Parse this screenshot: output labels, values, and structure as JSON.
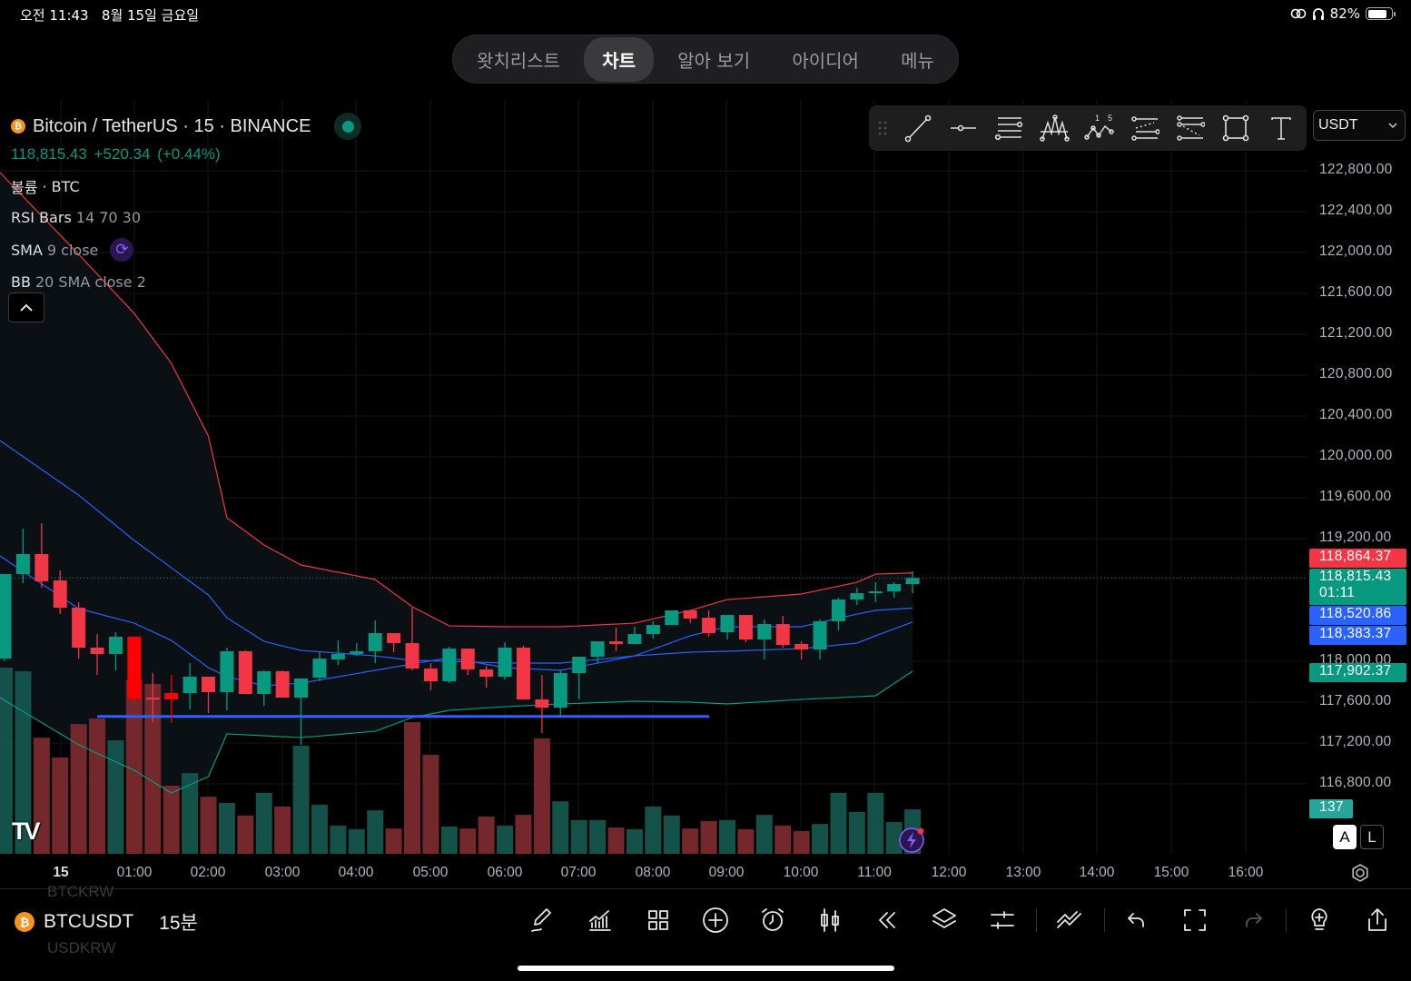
{
  "status_bar": {
    "time_date": "오전 11:43   8월 15일 금요일",
    "battery": "82%",
    "battery_level": 0.82,
    "icons": [
      "link-icon",
      "headphones-icon",
      "battery-icon"
    ]
  },
  "tabs": [
    {
      "label": "왓치리스트",
      "selected": false
    },
    {
      "label": "차트",
      "selected": true
    },
    {
      "label": "알아 보기",
      "selected": false
    },
    {
      "label": "아이디어",
      "selected": false
    },
    {
      "label": "메뉴",
      "selected": false
    }
  ],
  "legend": {
    "title": "Bitcoin / TetherUS · 15 · BINANCE",
    "quote": "118,815.43 +520.34 (+0.44%)",
    "indicators": [
      {
        "name": "볼륨",
        "params": "· BTC"
      },
      {
        "name": "RSI Bars",
        "params": "14 70 30"
      },
      {
        "name": "SMA",
        "params": "9 close"
      },
      {
        "name": "BB",
        "params": "20 SMA close 2"
      }
    ]
  },
  "drawing_toolbar": [
    "drag-handle-icon",
    "trend-line-icon",
    "horizontal-ray-icon",
    "fib-retracement-icon",
    "pattern-icon",
    "elliott-wave-icon",
    "parallel-channel-icon",
    "regression-trend-icon",
    "rectangle-icon",
    "text-icon"
  ],
  "currency_select": "USDT",
  "colors": {
    "up": "#089981",
    "down": "#f23645",
    "rsi_extreme": "#ff0000",
    "bb_upper": "#f23645",
    "bb_basis": "#2962ff",
    "bb_lower": "#089981",
    "sma": "#2962ff",
    "hline": "#2962ff"
  },
  "price_axis": {
    "labels": [
      "122,800.00",
      "122,400.00",
      "122,000.00",
      "121,600.00",
      "121,200.00",
      "120,800.00",
      "120,400.00",
      "120,000.00",
      "119,600.00",
      "119,200.00",
      "118,000.00",
      "117,600.00",
      "117,200.00",
      "116,800.00"
    ],
    "values": [
      122800,
      122400,
      122000,
      121600,
      121200,
      120800,
      120400,
      120000,
      119600,
      119200,
      118000,
      117600,
      117200,
      116800
    ]
  },
  "price_labels": [
    {
      "value": "118,864.37",
      "color": "#f23645",
      "price": 118864.37
    },
    {
      "value": "118,815.43",
      "sub": "01:11",
      "color": "#089981",
      "price": 118815.43
    },
    {
      "value": "118,520.86",
      "color": "#2962ff",
      "price": 118520.86
    },
    {
      "value": "118,383.37",
      "color": "#2962ff",
      "price": 118383.37
    },
    {
      "value": "117,902.37",
      "color": "#089981",
      "price": 117902.37
    }
  ],
  "volume_label": "137",
  "scale_buttons": {
    "auto": "A",
    "log": "L"
  },
  "time_axis": [
    "15",
    "01:00",
    "02:00",
    "03:00",
    "04:00",
    "05:00",
    "06:00",
    "07:00",
    "08:00",
    "09:00",
    "10:00",
    "11:00",
    "12:00",
    "13:00",
    "14:00",
    "15:00",
    "16:00"
  ],
  "chart_data": {
    "type": "candlestick",
    "symbol": "BTCUSDT",
    "interval": "15",
    "ylim": [
      116800,
      122800
    ],
    "columns": [
      "time",
      "open",
      "high",
      "low",
      "close",
      "volume"
    ],
    "candles": [
      [
        "23:15",
        118026,
        118853,
        118000,
        118853,
        574
      ],
      [
        "23:30",
        118853,
        119298,
        118764,
        119049,
        563
      ],
      [
        "23:45",
        119049,
        119351,
        118720,
        118782,
        358
      ],
      [
        "00:00",
        118791,
        118889,
        118462,
        118524,
        297
      ],
      [
        "00:15",
        118524,
        118578,
        118026,
        118133,
        400
      ],
      [
        "00:30",
        118133,
        118266,
        117866,
        118071,
        417
      ],
      [
        "00:45",
        118071,
        118284,
        117911,
        118240,
        350
      ],
      [
        "01:00",
        118240,
        118240,
        117600,
        117635,
        535
      ],
      [
        "01:15",
        117644,
        117884,
        117404,
        117626,
        524
      ],
      [
        "01:30",
        117689,
        117866,
        117395,
        117626,
        210
      ],
      [
        "01:45",
        117689,
        117982,
        117529,
        117849,
        249
      ],
      [
        "02:00",
        117849,
        117849,
        117493,
        117698,
        176
      ],
      [
        "02:15",
        117698,
        118133,
        117520,
        118098,
        157
      ],
      [
        "02:30",
        118098,
        118106,
        117680,
        117680,
        118
      ],
      [
        "02:45",
        117680,
        117911,
        117564,
        117902,
        188
      ],
      [
        "03:00",
        117902,
        117911,
        117644,
        117644,
        146
      ],
      [
        "03:15",
        117644,
        117831,
        117182,
        117831,
        333
      ],
      [
        "03:30",
        117840,
        118089,
        117804,
        118026,
        151
      ],
      [
        "03:45",
        118017,
        118204,
        117964,
        118071,
        87
      ],
      [
        "04:00",
        118071,
        118178,
        118053,
        118098,
        76
      ],
      [
        "04:15",
        118098,
        118400,
        117982,
        118275,
        134
      ],
      [
        "04:30",
        118275,
        118275,
        118089,
        118178,
        78
      ],
      [
        "04:45",
        118178,
        118524,
        117911,
        117929,
        406
      ],
      [
        "05:00",
        117929,
        117982,
        117715,
        117804,
        305
      ],
      [
        "05:15",
        117804,
        118142,
        117786,
        118124,
        84
      ],
      [
        "05:30",
        118124,
        118124,
        117866,
        117920,
        78
      ],
      [
        "05:45",
        117920,
        117955,
        117742,
        117849,
        115
      ],
      [
        "06:00",
        117849,
        118186,
        117822,
        118133,
        87
      ],
      [
        "06:15",
        118133,
        118151,
        117626,
        117626,
        120
      ],
      [
        "06:30",
        117626,
        117866,
        117298,
        117546,
        356
      ],
      [
        "06:45",
        117546,
        117911,
        117458,
        117884,
        162
      ],
      [
        "07:00",
        117884,
        118044,
        117626,
        118044,
        104
      ],
      [
        "07:15",
        118044,
        118195,
        117982,
        118195,
        104
      ],
      [
        "07:30",
        118195,
        118329,
        118098,
        118169,
        81
      ],
      [
        "07:45",
        118169,
        118338,
        118169,
        118266,
        76
      ],
      [
        "08:00",
        118266,
        118391,
        118222,
        118355,
        146
      ],
      [
        "08:15",
        118355,
        118498,
        118355,
        118498,
        118
      ],
      [
        "08:30",
        118498,
        118498,
        118373,
        118418,
        78
      ],
      [
        "08:45",
        118426,
        118498,
        118240,
        118275,
        101
      ],
      [
        "09:00",
        118284,
        118453,
        118213,
        118453,
        104
      ],
      [
        "09:15",
        118453,
        118453,
        118186,
        118213,
        76
      ],
      [
        "09:30",
        118213,
        118409,
        118017,
        118364,
        120
      ],
      [
        "09:45",
        118364,
        118444,
        118133,
        118160,
        87
      ],
      [
        "10:00",
        118169,
        118195,
        118017,
        118115,
        70
      ],
      [
        "10:15",
        118115,
        118409,
        118017,
        118391,
        92
      ],
      [
        "10:30",
        118391,
        118622,
        118302,
        118604,
        188
      ],
      [
        "10:45",
        118604,
        118720,
        118551,
        118666,
        129
      ],
      [
        "11:00",
        118675,
        118773,
        118578,
        118684,
        188
      ],
      [
        "11:15",
        118684,
        118773,
        118622,
        118755,
        98
      ],
      [
        "11:30",
        118755,
        118880,
        118666,
        118815.43,
        137
      ]
    ],
    "rsi_extreme_times": [
      "01:00",
      "01:30"
    ],
    "indicators": {
      "times": [
        "23:15",
        "00:15",
        "01:00",
        "01:30",
        "02:00",
        "02:15",
        "02:45",
        "03:15",
        "04:15",
        "04:45",
        "05:15",
        "06:00",
        "06:45",
        "07:45",
        "08:30",
        "09:00",
        "10:00",
        "10:45",
        "11:00",
        "11:30"
      ],
      "bb_upper": [
        122782,
        121982,
        121404,
        120915,
        120204,
        119404,
        119138,
        118942,
        118800,
        118533,
        118346,
        118338,
        118338,
        118373,
        118498,
        118604,
        118658,
        118773,
        118853,
        118864.37
      ],
      "bb_basis": [
        120160,
        119626,
        119182,
        118915,
        118649,
        118426,
        118195,
        118106,
        118053,
        118009,
        118000,
        117982,
        117982,
        118053,
        118089,
        118098,
        118124,
        118178,
        118249,
        118383.37
      ],
      "bb_lower": [
        117644,
        117182,
        116933,
        116711,
        116871,
        117289,
        117271,
        117253,
        117315,
        117449,
        117520,
        117555,
        117582,
        117609,
        117600,
        117582,
        117626,
        117653,
        117662,
        117902.37
      ],
      "sma9": [
        119031,
        118515,
        118373,
        118204,
        117938,
        117849,
        117760,
        117786,
        117911,
        117973,
        118035,
        117938,
        117911,
        118053,
        118249,
        118338,
        118338,
        118462,
        118498,
        118520.86
      ]
    },
    "horizontal_line": {
      "price": 117460,
      "from": "00:30",
      "to": "09:00"
    }
  },
  "bottom_bar": {
    "symbol": "BTCUSDT",
    "interval": "15분",
    "ghost_above": "BTCKRW",
    "ghost_below": "USDKRW",
    "icons": [
      "pencil-icon",
      "indicators-icon",
      "layout-grid-icon",
      "add-circle-icon",
      "alarm-icon",
      "candle-style-icon",
      "replay-icon",
      "layers-icon",
      "settings-sliders-icon",
      "trend-icon",
      "undo-icon",
      "fullscreen-icon",
      "redo-icon",
      "ideas-bulb-icon",
      "share-icon"
    ]
  }
}
